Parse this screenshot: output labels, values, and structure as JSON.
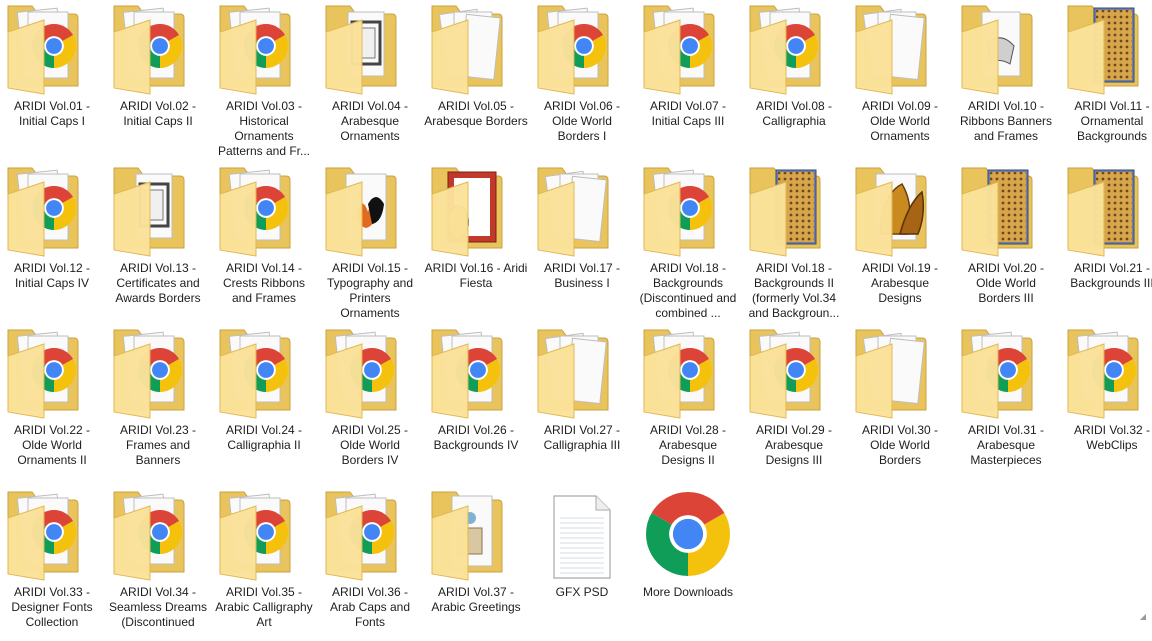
{
  "colors": {
    "folder_back": "#e9c45c",
    "folder_front": "#fbe29a",
    "folder_front_edge": "#e2b84e",
    "chrome_red": "#db4437",
    "chrome_yellow": "#f4c20d",
    "chrome_green": "#0f9d58",
    "chrome_blue": "#4285f4"
  },
  "items": [
    {
      "label": "ARIDI Vol.01 - Initial Caps I",
      "icon": "folder-chrome-icon"
    },
    {
      "label": "ARIDI Vol.02 - Initial Caps II",
      "icon": "folder-chrome-icon"
    },
    {
      "label": "ARIDI Vol.03 - Historical Ornaments Patterns and Fr...",
      "icon": "folder-chrome-icon"
    },
    {
      "label": "ARIDI Vol.04 - Arabesque Ornaments",
      "icon": "folder-frame-icon"
    },
    {
      "label": "ARIDI Vol.05 - Arabesque Borders",
      "icon": "folder-pages-icon"
    },
    {
      "label": "ARIDI Vol.06 - Olde World Borders I",
      "icon": "folder-chrome-icon"
    },
    {
      "label": "ARIDI Vol.07 - Initial Caps III",
      "icon": "folder-chrome-icon"
    },
    {
      "label": "ARIDI Vol.08 - Calligraphia",
      "icon": "folder-chrome-icon"
    },
    {
      "label": "ARIDI Vol.09 - Olde World Ornaments",
      "icon": "folder-pages-icon"
    },
    {
      "label": "ARIDI Vol.10 - Ribbons Banners and Frames",
      "icon": "folder-ribbon-icon"
    },
    {
      "label": "ARIDI Vol.11 - Ornamental Backgrounds",
      "icon": "folder-pattern-icon"
    },
    {
      "label": "ARIDI Vol.12 - Initial Caps IV",
      "icon": "folder-chrome-icon"
    },
    {
      "label": "ARIDI Vol.13 - Certificates and Awards Borders",
      "icon": "folder-frame-icon"
    },
    {
      "label": "ARIDI Vol.14 - Crests Ribbons and Frames",
      "icon": "folder-chrome-icon"
    },
    {
      "label": "ARIDI Vol.15 - Typography and Printers Ornaments",
      "icon": "folder-splash-icon"
    },
    {
      "label": "ARIDI Vol.16 - Aridi Fiesta",
      "icon": "folder-fiesta-icon"
    },
    {
      "label": "ARIDI Vol.17 - Business I",
      "icon": "folder-pages-icon"
    },
    {
      "label": "ARIDI Vol.18 - Backgrounds (Discontinued and combined ...",
      "icon": "folder-chrome-icon"
    },
    {
      "label": "ARIDI Vol.18 - Backgrounds II (formerly Vol.34 and Backgroun...",
      "icon": "folder-pattern-icon"
    },
    {
      "label": "ARIDI Vol.19 - Arabesque Designs",
      "icon": "folder-arabesque-icon"
    },
    {
      "label": "ARIDI Vol.20 - Olde World Borders III",
      "icon": "folder-pattern-icon"
    },
    {
      "label": "ARIDI Vol.21 - Backgrounds III",
      "icon": "folder-pattern-icon"
    },
    {
      "label": "ARIDI Vol.22 - Olde World Ornaments II",
      "icon": "folder-chrome-icon"
    },
    {
      "label": "ARIDI Vol.23 - Frames and Banners",
      "icon": "folder-chrome-icon"
    },
    {
      "label": "ARIDI Vol.24 - Calligraphia II",
      "icon": "folder-chrome-icon"
    },
    {
      "label": "ARIDI Vol.25 - Olde World Borders IV",
      "icon": "folder-chrome-icon"
    },
    {
      "label": "ARIDI Vol.26 - Backgrounds IV",
      "icon": "folder-chrome-icon"
    },
    {
      "label": "ARIDI Vol.27 - Calligraphia III",
      "icon": "folder-pages-icon"
    },
    {
      "label": "ARIDI Vol.28 - Arabesque Designs II",
      "icon": "folder-chrome-icon"
    },
    {
      "label": "ARIDI Vol.29 - Arabesque Designs III",
      "icon": "folder-chrome-icon"
    },
    {
      "label": "ARIDI Vol.30 - Olde World Borders",
      "icon": "folder-pages-icon"
    },
    {
      "label": "ARIDI Vol.31 - Arabesque Masterpieces",
      "icon": "folder-chrome-icon"
    },
    {
      "label": "ARIDI Vol.32 - WebClips",
      "icon": "folder-chrome-icon"
    },
    {
      "label": "ARIDI Vol.33 - Designer Fonts Collection",
      "icon": "folder-chrome-icon"
    },
    {
      "label": "ARIDI Vol.34 - Seamless Dreams (Discontinued",
      "icon": "folder-chrome-icon"
    },
    {
      "label": "ARIDI Vol.35 - Arabic Calligraphy Art",
      "icon": "folder-chrome-icon"
    },
    {
      "label": "ARIDI Vol.36 - Arab Caps and Fonts",
      "icon": "folder-chrome-icon"
    },
    {
      "label": "ARIDI Vol.37 - Arabic Greetings",
      "icon": "folder-card-icon"
    },
    {
      "label": "GFX PSD",
      "icon": "text-file-icon"
    },
    {
      "label": "More Downloads",
      "icon": "chrome-icon"
    }
  ]
}
